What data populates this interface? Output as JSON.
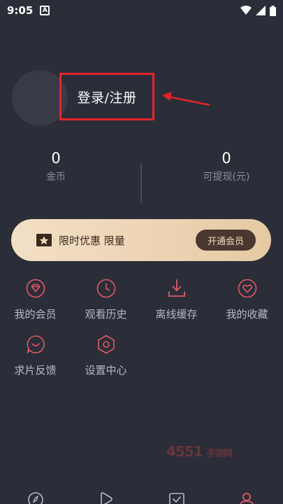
{
  "status_bar": {
    "time": "9:05",
    "notification_letter": "A"
  },
  "profile": {
    "login_label": "登录/注册"
  },
  "stats": {
    "coins": {
      "value": "0",
      "label": "金币"
    },
    "withdrawable": {
      "value": "0",
      "label": "可提现(元)"
    }
  },
  "vip_banner": {
    "text": "限时优惠 限量",
    "button_label": "开通会员",
    "colors": {
      "banner": "#f0d8bb",
      "button": "#4a3830"
    }
  },
  "menu": [
    {
      "label": "我的会员",
      "icon": "diamond-icon"
    },
    {
      "label": "观看历史",
      "icon": "clock-icon"
    },
    {
      "label": "离线缓存",
      "icon": "download-icon"
    },
    {
      "label": "我的收藏",
      "icon": "heart-icon"
    },
    {
      "label": "求片反馈",
      "icon": "chat-icon"
    },
    {
      "label": "设置中心",
      "icon": "hexagon-settings-icon"
    }
  ],
  "watermark": {
    "text": "4551",
    "sub": "手游网"
  },
  "tabbar": [
    "compass-icon",
    "play-icon",
    "check-icon",
    "user-icon"
  ],
  "colors": {
    "background": "#2b2d38",
    "accent": "#e05a66",
    "highlight_box": "#e3242b"
  }
}
